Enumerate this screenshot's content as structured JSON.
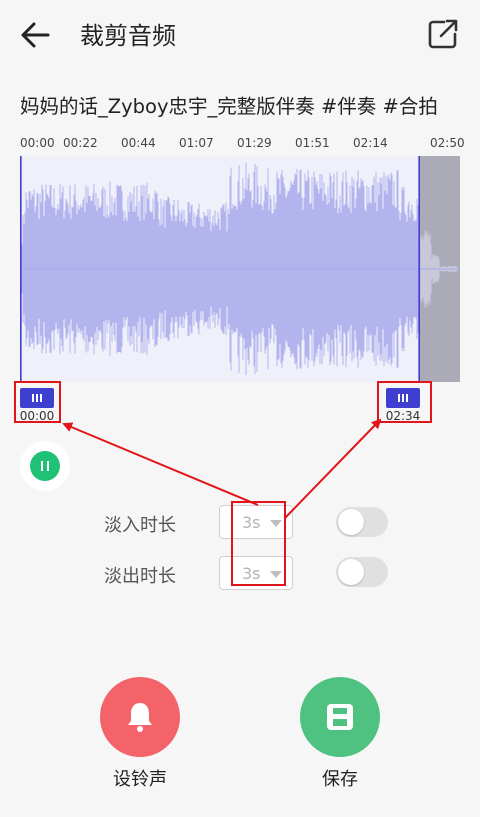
{
  "header": {
    "title": "裁剪音频",
    "back_icon": "arrow-left-icon",
    "share_icon": "external-share-icon"
  },
  "song": {
    "title": "妈妈的话_Zyboy忠宇_完整版伴奏 #伴奏 #合拍"
  },
  "timeline": {
    "ticks": [
      "00:00",
      "00:22",
      "00:44",
      "01:07",
      "01:29",
      "01:51",
      "02:14",
      "02:50"
    ]
  },
  "trim": {
    "start_time": "00:00",
    "end_time": "02:34",
    "waveform_color": "#b3b3ee",
    "handle_color": "#3e3ed0"
  },
  "fade_in": {
    "label": "淡入时长",
    "value": "3s",
    "enabled": false
  },
  "fade_out": {
    "label": "淡出时长",
    "value": "3s",
    "enabled": false
  },
  "actions": {
    "ringtone": {
      "label": "设铃声",
      "color": "#f36369",
      "icon": "bell-icon"
    },
    "save": {
      "label": "保存",
      "color": "#4fc181",
      "icon": "floppy-disk-icon"
    }
  },
  "annotation_color": "#e0161b"
}
